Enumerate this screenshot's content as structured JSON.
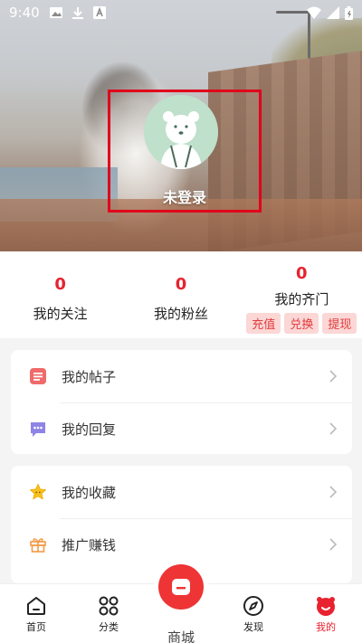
{
  "status_bar": {
    "time": "9:40"
  },
  "profile": {
    "login_text": "未登录",
    "colors": {
      "highlight_box": "#e0001b",
      "avatar_bg": "#bfe0cb"
    }
  },
  "stats": [
    {
      "value": "0",
      "label": "我的关注"
    },
    {
      "value": "0",
      "label": "我的粉丝"
    },
    {
      "value": "0",
      "label": "我的齐门"
    }
  ],
  "wallet_actions": [
    "充值",
    "兑换",
    "提现"
  ],
  "menu_group1": [
    {
      "label": "我的帖子",
      "icon": "post-icon"
    },
    {
      "label": "我的回复",
      "icon": "reply-icon"
    }
  ],
  "menu_group2": [
    {
      "label": "我的收藏",
      "icon": "star-icon"
    },
    {
      "label": "推广赚钱",
      "icon": "gift-icon"
    }
  ],
  "bottom_nav": {
    "home": "首页",
    "category": "分类",
    "mall": "商城",
    "discover": "发现",
    "mine": "我的"
  },
  "colors": {
    "accent": "#e8222f",
    "chip_bg": "#fbd7d6"
  }
}
